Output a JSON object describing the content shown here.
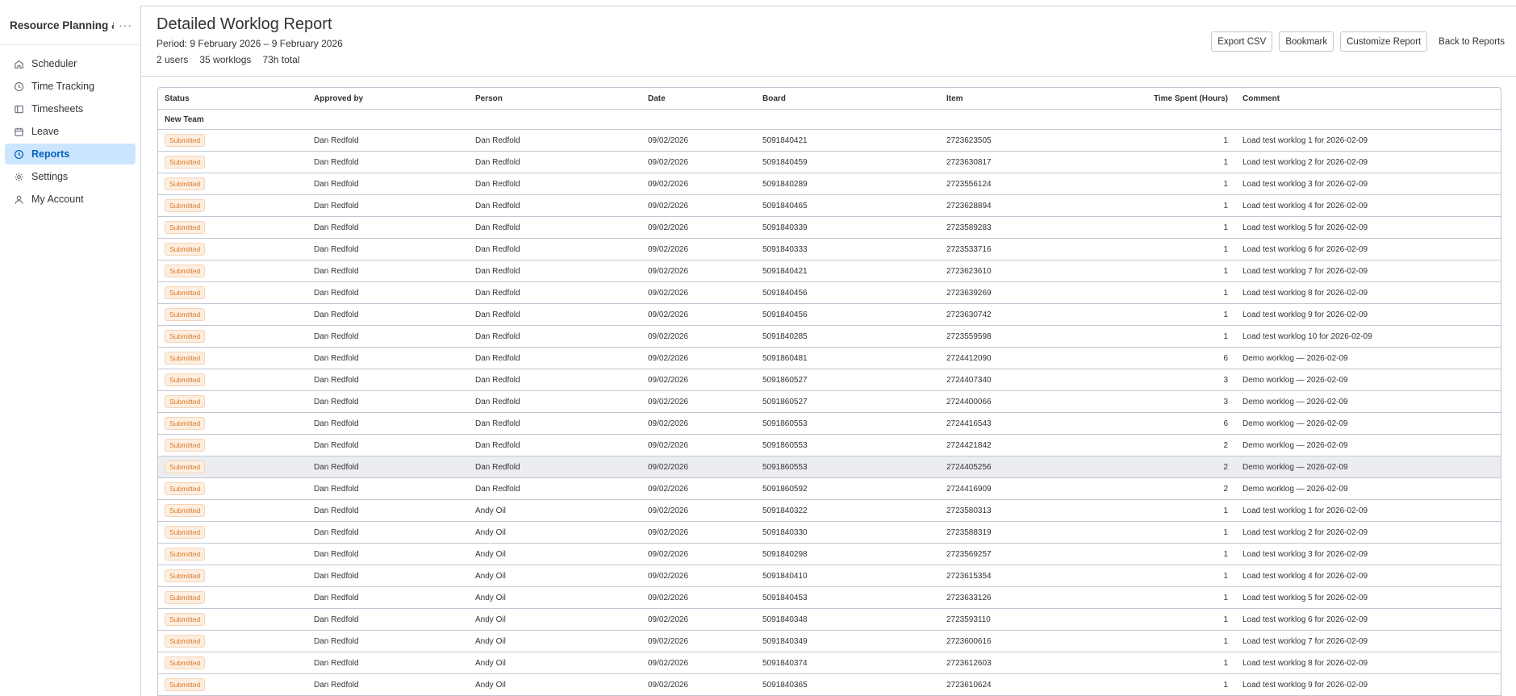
{
  "sidebar": {
    "app_title": "Resource Planning &...",
    "more_label": "···",
    "items": [
      {
        "label": "Scheduler",
        "icon": "home-icon"
      },
      {
        "label": "Time Tracking",
        "icon": "clock-icon"
      },
      {
        "label": "Timesheets",
        "icon": "timesheet-icon"
      },
      {
        "label": "Leave",
        "icon": "calendar-icon"
      },
      {
        "label": "Reports",
        "icon": "reports-clock-icon",
        "active": true
      },
      {
        "label": "Settings",
        "icon": "gear-icon"
      },
      {
        "label": "My Account",
        "icon": "person-icon"
      }
    ]
  },
  "header": {
    "title": "Detailed Worklog Report",
    "period": "Period: 9 February 2026 – 9 February 2026",
    "stats": {
      "users": "2 users",
      "worklogs": "35 worklogs",
      "total": "73h total"
    },
    "actions": {
      "export": "Export CSV",
      "bookmark": "Bookmark",
      "customize": "Customize Report",
      "back": "Back to Reports"
    }
  },
  "table": {
    "columns": [
      "Status",
      "Approved by",
      "Person",
      "Date",
      "Board",
      "Item",
      "Time Spent (Hours)",
      "Comment"
    ],
    "group": "New Team",
    "rows": [
      {
        "status": "Submitted",
        "approved_by": "Dan Redfold",
        "person": "Dan Redfold",
        "date": "09/02/2026",
        "board": "5091840421",
        "item": "2723623505",
        "hours": "1",
        "comment": "Load test worklog 1 for 2026-02-09"
      },
      {
        "status": "Submitted",
        "approved_by": "Dan Redfold",
        "person": "Dan Redfold",
        "date": "09/02/2026",
        "board": "5091840459",
        "item": "2723630817",
        "hours": "1",
        "comment": "Load test worklog 2 for 2026-02-09"
      },
      {
        "status": "Submitted",
        "approved_by": "Dan Redfold",
        "person": "Dan Redfold",
        "date": "09/02/2026",
        "board": "5091840289",
        "item": "2723556124",
        "hours": "1",
        "comment": "Load test worklog 3 for 2026-02-09"
      },
      {
        "status": "Submitted",
        "approved_by": "Dan Redfold",
        "person": "Dan Redfold",
        "date": "09/02/2026",
        "board": "5091840465",
        "item": "2723628894",
        "hours": "1",
        "comment": "Load test worklog 4 for 2026-02-09"
      },
      {
        "status": "Submitted",
        "approved_by": "Dan Redfold",
        "person": "Dan Redfold",
        "date": "09/02/2026",
        "board": "5091840339",
        "item": "2723589283",
        "hours": "1",
        "comment": "Load test worklog 5 for 2026-02-09"
      },
      {
        "status": "Submitted",
        "approved_by": "Dan Redfold",
        "person": "Dan Redfold",
        "date": "09/02/2026",
        "board": "5091840333",
        "item": "2723533716",
        "hours": "1",
        "comment": "Load test worklog 6 for 2026-02-09"
      },
      {
        "status": "Submitted",
        "approved_by": "Dan Redfold",
        "person": "Dan Redfold",
        "date": "09/02/2026",
        "board": "5091840421",
        "item": "2723623610",
        "hours": "1",
        "comment": "Load test worklog 7 for 2026-02-09"
      },
      {
        "status": "Submitted",
        "approved_by": "Dan Redfold",
        "person": "Dan Redfold",
        "date": "09/02/2026",
        "board": "5091840456",
        "item": "2723639269",
        "hours": "1",
        "comment": "Load test worklog 8 for 2026-02-09"
      },
      {
        "status": "Submitted",
        "approved_by": "Dan Redfold",
        "person": "Dan Redfold",
        "date": "09/02/2026",
        "board": "5091840456",
        "item": "2723630742",
        "hours": "1",
        "comment": "Load test worklog 9 for 2026-02-09"
      },
      {
        "status": "Submitted",
        "approved_by": "Dan Redfold",
        "person": "Dan Redfold",
        "date": "09/02/2026",
        "board": "5091840285",
        "item": "2723559598",
        "hours": "1",
        "comment": "Load test worklog 10 for 2026-02-09"
      },
      {
        "status": "Submitted",
        "approved_by": "Dan Redfold",
        "person": "Dan Redfold",
        "date": "09/02/2026",
        "board": "5091860481",
        "item": "2724412090",
        "hours": "6",
        "comment": "Demo worklog — 2026-02-09"
      },
      {
        "status": "Submitted",
        "approved_by": "Dan Redfold",
        "person": "Dan Redfold",
        "date": "09/02/2026",
        "board": "5091860527",
        "item": "2724407340",
        "hours": "3",
        "comment": "Demo worklog — 2026-02-09"
      },
      {
        "status": "Submitted",
        "approved_by": "Dan Redfold",
        "person": "Dan Redfold",
        "date": "09/02/2026",
        "board": "5091860527",
        "item": "2724400066",
        "hours": "3",
        "comment": "Demo worklog — 2026-02-09"
      },
      {
        "status": "Submitted",
        "approved_by": "Dan Redfold",
        "person": "Dan Redfold",
        "date": "09/02/2026",
        "board": "5091860553",
        "item": "2724416543",
        "hours": "6",
        "comment": "Demo worklog — 2026-02-09"
      },
      {
        "status": "Submitted",
        "approved_by": "Dan Redfold",
        "person": "Dan Redfold",
        "date": "09/02/2026",
        "board": "5091860553",
        "item": "2724421842",
        "hours": "2",
        "comment": "Demo worklog — 2026-02-09"
      },
      {
        "status": "Submitted",
        "approved_by": "Dan Redfold",
        "person": "Dan Redfold",
        "date": "09/02/2026",
        "board": "5091860553",
        "item": "2724405256",
        "hours": "2",
        "comment": "Demo worklog — 2026-02-09",
        "hover": true
      },
      {
        "status": "Submitted",
        "approved_by": "Dan Redfold",
        "person": "Dan Redfold",
        "date": "09/02/2026",
        "board": "5091860592",
        "item": "2724416909",
        "hours": "2",
        "comment": "Demo worklog — 2026-02-09"
      },
      {
        "status": "Submitted",
        "approved_by": "Dan Redfold",
        "person": "Andy Oil",
        "date": "09/02/2026",
        "board": "5091840322",
        "item": "2723580313",
        "hours": "1",
        "comment": "Load test worklog 1 for 2026-02-09"
      },
      {
        "status": "Submitted",
        "approved_by": "Dan Redfold",
        "person": "Andy Oil",
        "date": "09/02/2026",
        "board": "5091840330",
        "item": "2723588319",
        "hours": "1",
        "comment": "Load test worklog 2 for 2026-02-09"
      },
      {
        "status": "Submitted",
        "approved_by": "Dan Redfold",
        "person": "Andy Oil",
        "date": "09/02/2026",
        "board": "5091840298",
        "item": "2723569257",
        "hours": "1",
        "comment": "Load test worklog 3 for 2026-02-09"
      },
      {
        "status": "Submitted",
        "approved_by": "Dan Redfold",
        "person": "Andy Oil",
        "date": "09/02/2026",
        "board": "5091840410",
        "item": "2723615354",
        "hours": "1",
        "comment": "Load test worklog 4 for 2026-02-09"
      },
      {
        "status": "Submitted",
        "approved_by": "Dan Redfold",
        "person": "Andy Oil",
        "date": "09/02/2026",
        "board": "5091840453",
        "item": "2723633126",
        "hours": "1",
        "comment": "Load test worklog 5 for 2026-02-09"
      },
      {
        "status": "Submitted",
        "approved_by": "Dan Redfold",
        "person": "Andy Oil",
        "date": "09/02/2026",
        "board": "5091840348",
        "item": "2723593110",
        "hours": "1",
        "comment": "Load test worklog 6 for 2026-02-09"
      },
      {
        "status": "Submitted",
        "approved_by": "Dan Redfold",
        "person": "Andy Oil",
        "date": "09/02/2026",
        "board": "5091840349",
        "item": "2723600616",
        "hours": "1",
        "comment": "Load test worklog 7 for 2026-02-09"
      },
      {
        "status": "Submitted",
        "approved_by": "Dan Redfold",
        "person": "Andy Oil",
        "date": "09/02/2026",
        "board": "5091840374",
        "item": "2723612603",
        "hours": "1",
        "comment": "Load test worklog 8 for 2026-02-09"
      },
      {
        "status": "Submitted",
        "approved_by": "Dan Redfold",
        "person": "Andy Oil",
        "date": "09/02/2026",
        "board": "5091840365",
        "item": "2723610624",
        "hours": "1",
        "comment": "Load test worklog 9 for 2026-02-09"
      }
    ]
  }
}
